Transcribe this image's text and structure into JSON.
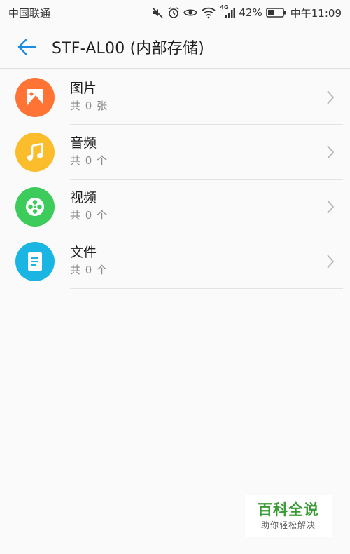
{
  "status_bar": {
    "carrier": "中国联通",
    "network": "4G",
    "battery_percent": "42%",
    "time": "中午11:09",
    "battery_level": 0.42,
    "icons": [
      "mute-icon",
      "alarm-icon",
      "eye-icon",
      "wifi-icon",
      "signal-icon",
      "battery-icon"
    ]
  },
  "app_bar": {
    "back_icon": "arrow-left-icon",
    "title": "STF-AL00 (内部存储)"
  },
  "items": [
    {
      "title": "图片",
      "subtitle": "共 0 张",
      "icon": "image-icon",
      "color": "#ff7334"
    },
    {
      "title": "音频",
      "subtitle": "共 0 个",
      "icon": "music-note-icon",
      "color": "#fbbd2c"
    },
    {
      "title": "视频",
      "subtitle": "共 0 个",
      "icon": "film-reel-icon",
      "color": "#3dcb5c"
    },
    {
      "title": "文件",
      "subtitle": "共 0 个",
      "icon": "document-icon",
      "color": "#1ab5e3"
    }
  ],
  "watermark": {
    "title": "百科全说",
    "subtitle": "助你轻松解决"
  },
  "colors": {
    "accent": "#1d8ce0",
    "background": "#fafafa"
  }
}
